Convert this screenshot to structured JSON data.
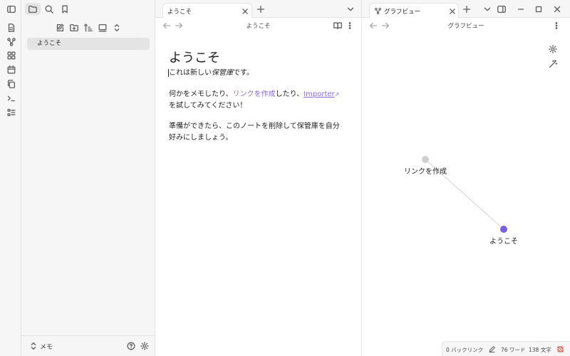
{
  "sidebar": {
    "files": [
      {
        "name": "ようこそ"
      }
    ],
    "vault_name": "メモ"
  },
  "left_pane": {
    "tab_title": "ようこそ",
    "view_title": "ようこそ",
    "note": {
      "title": "ようこそ",
      "line1_prefix": "これは新しい",
      "line1_emph": "保管庫",
      "line1_suffix": "です。",
      "line2_prefix": "何かをメモしたり、",
      "line2_link": "リンクを作成",
      "line2_mid": "したり、",
      "line2_ext": "Importer",
      "line2_suffix": "を試してみてください！",
      "line3": "準備ができたら、このノートを削除して保管庫を自分好みにしましょう。"
    }
  },
  "right_pane": {
    "tab_title": "グラフビュー",
    "view_title": "グラフビュー",
    "graph": {
      "nodes": [
        {
          "label": "リンクを作成",
          "color": "#d0d0d0"
        },
        {
          "label": "ようこそ",
          "color": "#7a5fe0"
        }
      ]
    }
  },
  "status": {
    "backlinks": "0 バックリンク",
    "words": "76 ワード",
    "chars": "138 文字"
  },
  "colors": {
    "accent": "#8a6bdd",
    "node_active": "#7a5fe0",
    "sync_error": "#e0514b"
  }
}
